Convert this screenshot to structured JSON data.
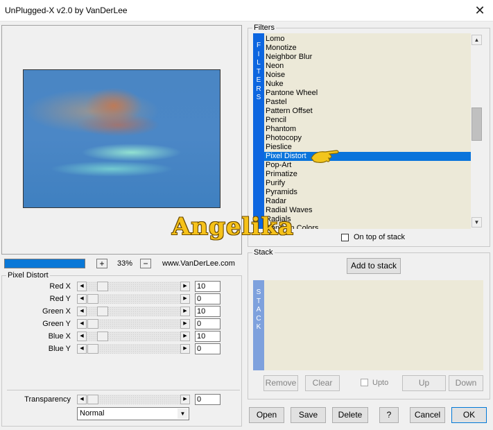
{
  "window": {
    "title": "UnPlugged-X v2.0 by VanDerLee",
    "close_glyph": "✕"
  },
  "preview": {
    "zoom_minus": "−",
    "zoom_plus": "+",
    "zoom_value": "33%",
    "website": "www.VanDerLee.com"
  },
  "pixel_distort": {
    "group_label": "Pixel Distort",
    "sliders": [
      {
        "label": "Red X",
        "value": "10"
      },
      {
        "label": "Red Y",
        "value": "0"
      },
      {
        "label": "Green X",
        "value": "10"
      },
      {
        "label": "Green Y",
        "value": "0"
      },
      {
        "label": "Blue X",
        "value": "10"
      },
      {
        "label": "Blue Y",
        "value": "0"
      }
    ],
    "transparency": {
      "label": "Transparency",
      "value": "0"
    },
    "blend_mode": "Normal"
  },
  "filters": {
    "group_label": "Filters",
    "side_letters": [
      "F",
      "I",
      "L",
      "T",
      "E",
      "R",
      "S"
    ],
    "items": [
      "Lomo",
      "Monotize",
      "Neighbor Blur",
      "Neon",
      "Noise",
      "Nuke",
      "Pantone Wheel",
      "Pastel",
      "Pattern Offset",
      "Pencil",
      "Phantom",
      "Photocopy",
      "Pieslice",
      "Pixel Distort",
      "Pop-Art",
      "Primatize",
      "Purify",
      "Pyramids",
      "Radar",
      "Radial Waves",
      "Radials",
      "Random Colors"
    ],
    "selected": "Pixel Distort",
    "on_top_label": "On top of stack"
  },
  "stack": {
    "group_label": "Stack",
    "add_button": "Add to stack",
    "side_letters": [
      "S",
      "T",
      "A",
      "C",
      "K"
    ],
    "remove": "Remove",
    "clear": "Clear",
    "upto": "Upto",
    "up": "Up",
    "down": "Down"
  },
  "buttons": {
    "open": "Open",
    "save": "Save",
    "delete": "Delete",
    "help": "?",
    "cancel": "Cancel",
    "ok": "OK"
  },
  "watermark": "Angelika",
  "colors": {
    "accent": "#0a74db",
    "list_bg": "#ece9d8",
    "filters_bar": "#0d66e0",
    "stack_bar": "#7ea1dd"
  }
}
